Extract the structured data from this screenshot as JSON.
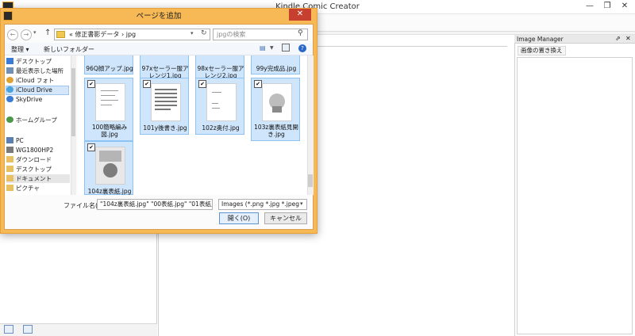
{
  "app": {
    "title": "Kindle Comic Creator",
    "minimize": "—",
    "restore": "❐",
    "close": "✕"
  },
  "image_manager": {
    "title": "Image Manager",
    "pin": "⇗",
    "close": "✕",
    "replace_button": "画像の置き換え"
  },
  "dialog": {
    "title": "ページを追加",
    "close": "✕",
    "nav": {
      "back": "←",
      "forward": "→",
      "history": "▾",
      "up": "↑"
    },
    "address": {
      "path": "«  修正書影データ  ›  jpg",
      "dropdown": "▾",
      "refresh": "↻"
    },
    "search": {
      "placeholder": "jpgの検索",
      "icon": "⚲"
    },
    "toolbar": {
      "organize": "整理 ▾",
      "new_folder": "新しいフォルダー",
      "view": "▤",
      "view_dd": "▼",
      "help": "?"
    },
    "nav_pane": [
      {
        "label": "デスクトップ",
        "color": "#3a7bd5"
      },
      {
        "label": "最近表示した場所",
        "color": "#6f8fb5"
      },
      {
        "label": "iCloud フォト",
        "color": "#e2a030"
      },
      {
        "label": "iCloud Drive",
        "color": "#4aa3df"
      },
      {
        "label": "SkyDrive",
        "color": "#3a7bd5"
      },
      {
        "label": "ホームグループ",
        "color": "#4a9a4a"
      },
      {
        "label": "PC",
        "color": "#5a7fb0"
      },
      {
        "label": "WG1800HP2",
        "color": "#7a7a7a"
      },
      {
        "label": "ダウンロード",
        "color": "#e8c060"
      },
      {
        "label": "デスクトップ",
        "color": "#e8c060"
      },
      {
        "label": "ドキュメント",
        "color": "#e8c060"
      },
      {
        "label": "ピクチャ",
        "color": "#e8c060"
      }
    ],
    "files": [
      {
        "label": "96Q顔アップ.jpg"
      },
      {
        "label": "97xセーラー服アレンジ1.jpg"
      },
      {
        "label": "98xセーラー服アレンジ2.jpg"
      },
      {
        "label": "99y完成品.jpg"
      },
      {
        "label": "100簡略編み図.jpg",
        "check": "✔"
      },
      {
        "label": "101y後書き.jpg",
        "check": "✔"
      },
      {
        "label": "102z奥付.jpg",
        "check": "✔"
      },
      {
        "label": "103z裏表紙見開き.jpg",
        "check": "✔"
      },
      {
        "label": "104z裏表紙.jpg",
        "check": "✔"
      }
    ],
    "filename_label": "ファイル名(N):",
    "filename_value": "\"104z裏表紙.jpg\" \"00表紙.jpg\" \"01表紙見",
    "filter_value": "Images (*.png *.jpg *.jpeg",
    "filter_dd": "▾",
    "open_button": "開く(O)",
    "cancel_button": "キャンセル"
  }
}
